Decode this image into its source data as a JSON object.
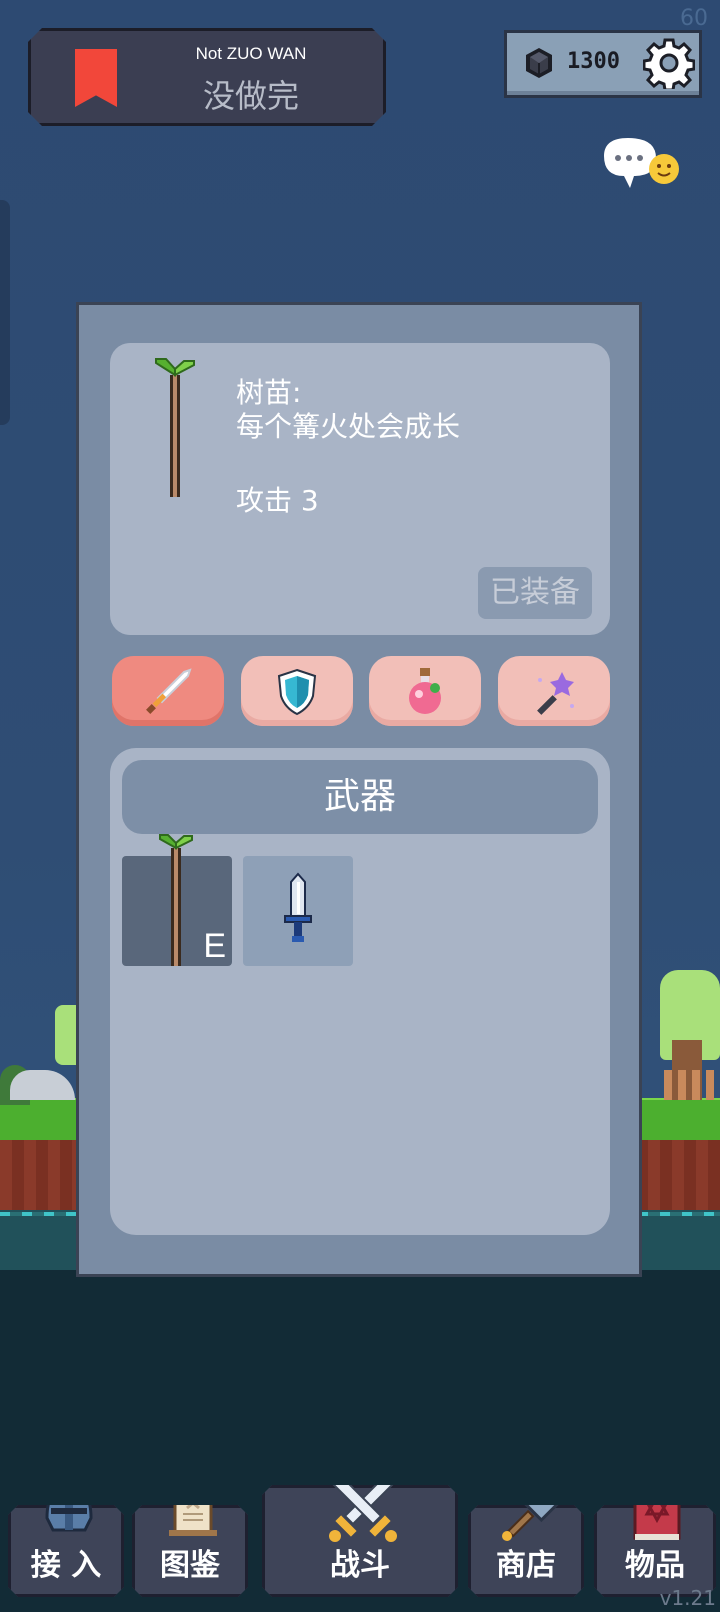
{
  "hud": {
    "fps": "60",
    "version": "v1.21",
    "title_en": "Not ZUO WAN",
    "title_cn": "没做完",
    "gems": "1300"
  },
  "item_detail": {
    "name": "树苗:",
    "description": "每个篝火处会成长",
    "attack": "攻击  3",
    "equipped_label": "已装备"
  },
  "category_tabs": [
    {
      "icon": "sword-icon",
      "active": true
    },
    {
      "icon": "shield-icon",
      "active": false
    },
    {
      "icon": "potion-icon",
      "active": false
    },
    {
      "icon": "magic-wand-icon",
      "active": false
    }
  ],
  "inventory": {
    "header": "武器",
    "slots": [
      {
        "icon": "sapling-stick-icon",
        "badge": "E",
        "equipped": true
      },
      {
        "icon": "short-sword-icon",
        "badge": "",
        "equipped": false
      }
    ]
  },
  "nav": [
    {
      "label": "接 入",
      "icon": "helmet-icon"
    },
    {
      "label": "图鉴",
      "icon": "scroll-icon"
    },
    {
      "label": "战斗",
      "icon": "crossed-swords-icon"
    },
    {
      "label": "商店",
      "icon": "hammer-icon"
    },
    {
      "label": "物品",
      "icon": "spellbook-icon"
    }
  ],
  "colors": {
    "accent_tab": "#ef8a80",
    "tab": "#f2bfb8",
    "panel": "#7a8ca4",
    "card": "#a9b4c6",
    "bookmark": "#f2473a"
  }
}
